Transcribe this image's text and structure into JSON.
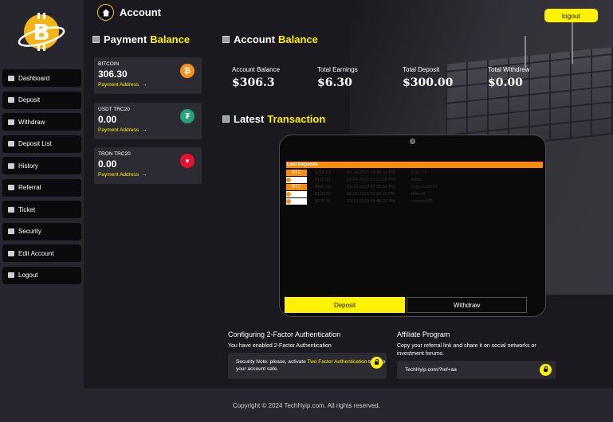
{
  "page": {
    "title": "Account"
  },
  "header": {
    "logout_label": "logout"
  },
  "sidebar": {
    "items": [
      {
        "label": "Dashboard",
        "icon": "dashboard-icon"
      },
      {
        "label": "Deposit",
        "icon": "wallet-icon"
      },
      {
        "label": "Withdraw",
        "icon": "withdraw-icon"
      },
      {
        "label": "Deposit List",
        "icon": "list-icon"
      },
      {
        "label": "History",
        "icon": "history-icon"
      },
      {
        "label": "Referral",
        "icon": "users-icon"
      },
      {
        "label": "Ticket",
        "icon": "ticket-icon"
      },
      {
        "label": "Security",
        "icon": "shield-icon"
      },
      {
        "label": "Edit Account",
        "icon": "edit-icon"
      },
      {
        "label": "Logout",
        "icon": "logout-icon"
      }
    ]
  },
  "payment_balance": {
    "title_plain": "Payment",
    "title_highlight": "Balance",
    "coins": [
      {
        "name": "BITCOIN",
        "value": "306.30",
        "link": "Payment Address",
        "arrow": "→",
        "icon": "bitcoin-icon",
        "glyph": "₿",
        "color": "#f7931a"
      },
      {
        "name": "USDT TRC20",
        "value": "0.00",
        "link": "Payment Address",
        "arrow": "→",
        "icon": "tether-icon",
        "glyph": "₮",
        "color": "#26a17b"
      },
      {
        "name": "TRON TRC20",
        "value": "0.00",
        "link": "Payment Address",
        "arrow": "→",
        "icon": "tron-icon",
        "glyph": "▼",
        "color": "#e8112d"
      }
    ]
  },
  "account_balance": {
    "title_plain": "Account",
    "title_highlight": "Balance",
    "stats": [
      {
        "label": "Account Balance",
        "value": "$306.3"
      },
      {
        "label": "Total Earnings",
        "value": "$6.30"
      },
      {
        "label": "Total Deposit",
        "value": "$300.00"
      },
      {
        "label": "Total Withdrew",
        "value": "$0.00"
      }
    ]
  },
  "latest_transaction": {
    "title_plain": "Latest",
    "title_highlight": "Transaction",
    "table_title": "Last Deposits",
    "rows": [
      {
        "badge": "BTC",
        "amount": "$218.03",
        "date": "03-14-2023 05:40:31 PM",
        "user": "Irvin718"
      },
      {
        "badge": "",
        "amount": "$116.50",
        "date": "03-14-2023 02:16:18 PM",
        "user": "Adda"
      },
      {
        "badge": "BTC",
        "amount": "$400.02",
        "date": "03-13-2023 07:55:06 PM",
        "user": "Impression74"
      },
      {
        "badge": "",
        "amount": "$110.00",
        "date": "03-13-2023 05:20:35 PM",
        "user": "Himself"
      },
      {
        "badge": "",
        "amount": "$275.00",
        "date": "03-13-2023 01:45:30 PM",
        "user": "Lesson003"
      }
    ],
    "deposit_tab": "Deposit",
    "withdraw_tab": "Withdraw"
  },
  "two_factor": {
    "title": "Configuring 2-Factor Authentication",
    "status": "You have enabled 2-Factor Authentication",
    "note_prefix": "Security Note: please, activate",
    "note_highlight": "Two Factor Authentication",
    "note_suffix": "to keep your account safe."
  },
  "affiliate": {
    "title": "Affiliate Program",
    "description": "Copy your referral link and share it on social networks or investment forums.",
    "referral_link": "TechHyip.com/?ref=aa"
  },
  "footer": {
    "copyright": "Copyright © 2024 TechHyip.com. All rights reserved."
  },
  "colors": {
    "accent": "#fff200",
    "orange": "#ff8c00",
    "sidebar_bg": "#27262e",
    "main_bg": "#1a1920"
  }
}
